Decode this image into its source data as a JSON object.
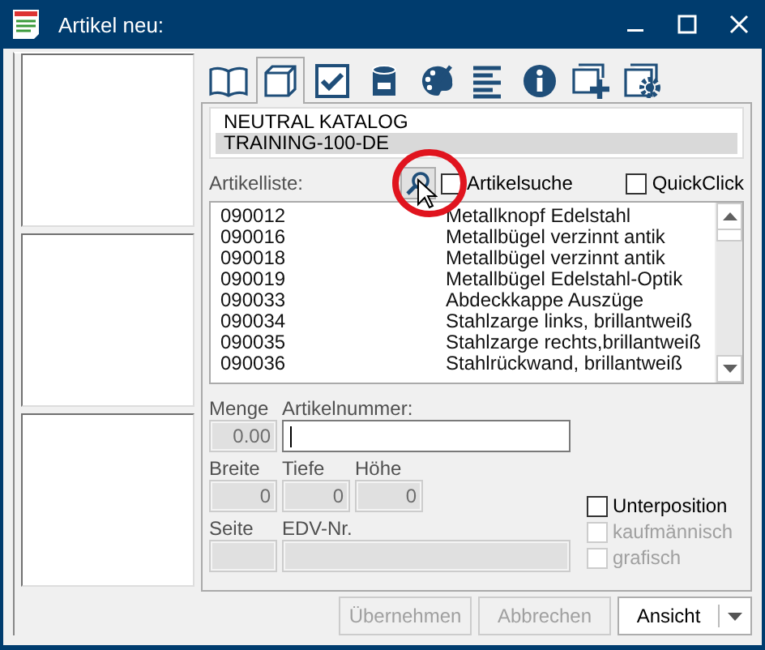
{
  "window": {
    "title": "Artikel neu:"
  },
  "tabs": [
    {
      "selected": false
    },
    {
      "selected": true
    },
    {
      "selected": false
    },
    {
      "selected": false
    },
    {
      "selected": false
    },
    {
      "selected": false
    },
    {
      "selected": false
    },
    {
      "selected": false
    },
    {
      "selected": false
    }
  ],
  "catalogs": [
    {
      "name": "NEUTRAL KATALOG",
      "selected": false
    },
    {
      "name": "TRAINING-100-DE",
      "selected": true
    }
  ],
  "article_list": {
    "label": "Artikelliste:",
    "search_checkbox": {
      "label": "Artikelsuche",
      "checked": false
    },
    "quickclick": {
      "label": "QuickClick",
      "checked": false
    },
    "rows": [
      {
        "number": "090012",
        "name": "Metallknopf Edelstahl"
      },
      {
        "number": "090016",
        "name": "Metallbügel verzinnt antik"
      },
      {
        "number": "090018",
        "name": "Metallbügel verzinnt antik"
      },
      {
        "number": "090019",
        "name": "Metallbügel Edelstahl-Optik"
      },
      {
        "number": "090033",
        "name": "Abdeckkappe Auszüge"
      },
      {
        "number": "090034",
        "name": "Stahlzarge links, brillantweiß"
      },
      {
        "number": "090035",
        "name": "Stahlzarge rechts,brillantweiß"
      },
      {
        "number": "090036",
        "name": "Stahlrückwand, brillantweiß"
      }
    ]
  },
  "fields": {
    "menge": {
      "label": "Menge",
      "value": "0.00"
    },
    "artikelnummer": {
      "label": "Artikelnummer:"
    },
    "breite": {
      "label": "Breite",
      "value": "0"
    },
    "tiefe": {
      "label": "Tiefe",
      "value": "0"
    },
    "hoehe": {
      "label": "Höhe",
      "value": "0"
    },
    "seite": {
      "label": "Seite"
    },
    "edv": {
      "label": "EDV-Nr."
    }
  },
  "options": [
    {
      "label": "Unterposition",
      "checked": false,
      "disabled": false
    },
    {
      "label": "kaufmännisch",
      "checked": false,
      "disabled": true
    },
    {
      "label": "grafisch",
      "checked": false,
      "disabled": true
    }
  ],
  "buttons": [
    {
      "label": "Übernehmen",
      "disabled": true
    },
    {
      "label": "Abbrechen",
      "disabled": true
    },
    {
      "label": "Ansicht",
      "disabled": false
    }
  ]
}
